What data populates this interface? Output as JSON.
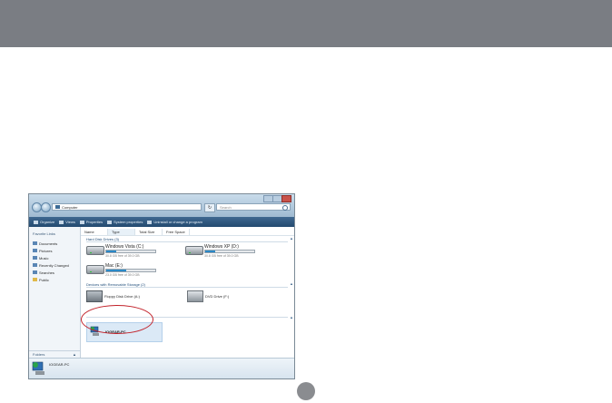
{
  "window": {
    "address": "Computer",
    "search_placeholder": "Search",
    "toolbar": [
      "Organize",
      "Views",
      "Properties",
      "System properties",
      "Uninstall or change a program"
    ]
  },
  "sidebar": {
    "heading": "Favorite Links",
    "items": [
      {
        "label": "Documents",
        "icon": "documents-icon"
      },
      {
        "label": "Pictures",
        "icon": "pictures-icon"
      },
      {
        "label": "Music",
        "icon": "music-icon"
      },
      {
        "label": "Recently Changed",
        "icon": "recently-changed-icon"
      },
      {
        "label": "Searches",
        "icon": "searches-icon"
      },
      {
        "label": "Public",
        "icon": "public-icon"
      }
    ],
    "folders_label": "Folders"
  },
  "columns": [
    "Name",
    "Type",
    "Total Size",
    "Free Space"
  ],
  "groups": {
    "hard_disks": "Hard Disk Drives (3)",
    "removable": "Devices with Removable Storage (2)"
  },
  "drives": [
    {
      "name": "Windows Vista (C:)",
      "free": "30.8 GB free of 39.0 GB",
      "used_fraction": 0.21
    },
    {
      "name": "Windows XP (D:)",
      "free": "30.8 GB free of 39.0 GB",
      "used_fraction": 0.21
    },
    {
      "name": "Mac (E:)",
      "free": "23.0 GB free of 39.0 GB",
      "used_fraction": 0.41
    }
  ],
  "devices": [
    {
      "name": "Floppy Disk Drive (A:)",
      "icon": "floppy-drive-icon"
    },
    {
      "name": "DVD Drive (F:)",
      "icon": "dvd-drive-icon"
    }
  ],
  "network_item": {
    "name": "IOGEAR-PC"
  },
  "details_pane": {
    "name": "IOGEAR-PC"
  },
  "colors": {
    "header_band": "#7a7d83",
    "highlight_ring": "#c2222a",
    "progress": "#1874b8"
  }
}
